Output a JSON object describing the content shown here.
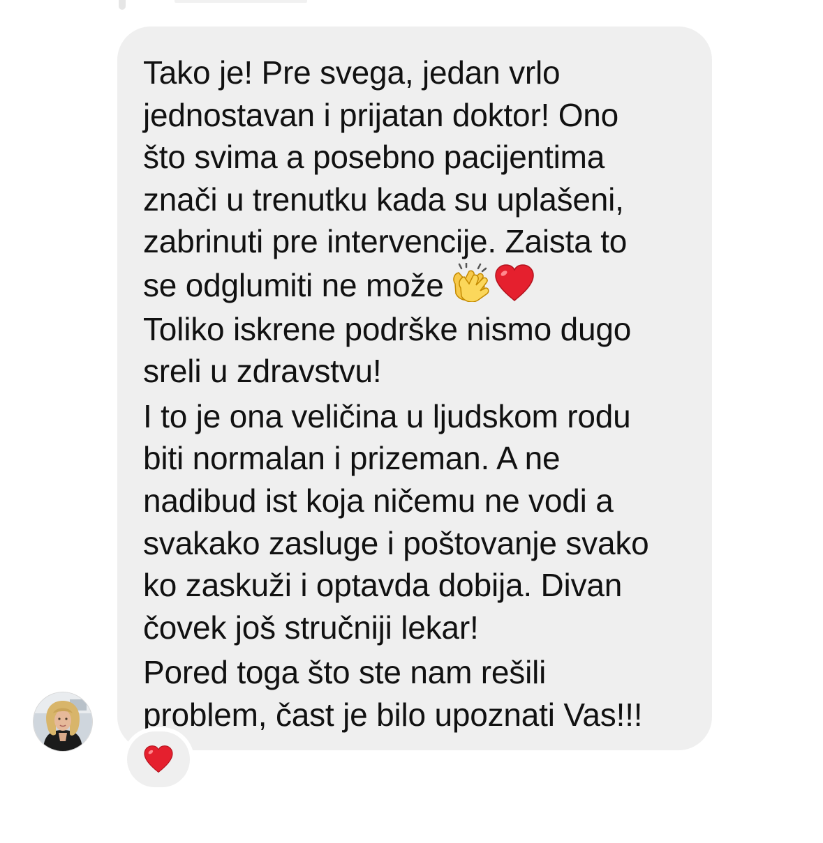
{
  "message": {
    "lines": [
      "Tako je! Pre svega, jedan vrlo",
      "jednostavan i prijatan doktor! Ono",
      "što svima a posebno pacijentima",
      "znači u trenutku kada su uplašeni,",
      "zabrinuti pre intervencije. Zaista to",
      "se odglumiti ne može",
      "Toliko iskrene podrške nismo dugo",
      "sreli u zdravstvu!",
      "I to je ona veličina u ljudskom rodu",
      "biti normalan i prizeman. A ne",
      "nadibud ist koja ničemu ne vodi a",
      "svakako zasluge i poštovanje svako",
      "ko zaskuži i optavda dobija. Divan",
      "čovek još stručniji lekar!",
      "Pored toga što ste nam rešili",
      "problem, čast je bilo upoznati Vas!!!"
    ],
    "inline_emojis": [
      "clapping-hands-icon",
      "red-heart-icon"
    ]
  },
  "reaction": {
    "emoji": "red-heart-icon"
  },
  "colors": {
    "bubble": "#efefef",
    "text": "#111111",
    "heart": "#e5202e",
    "background": "#ffffff"
  }
}
